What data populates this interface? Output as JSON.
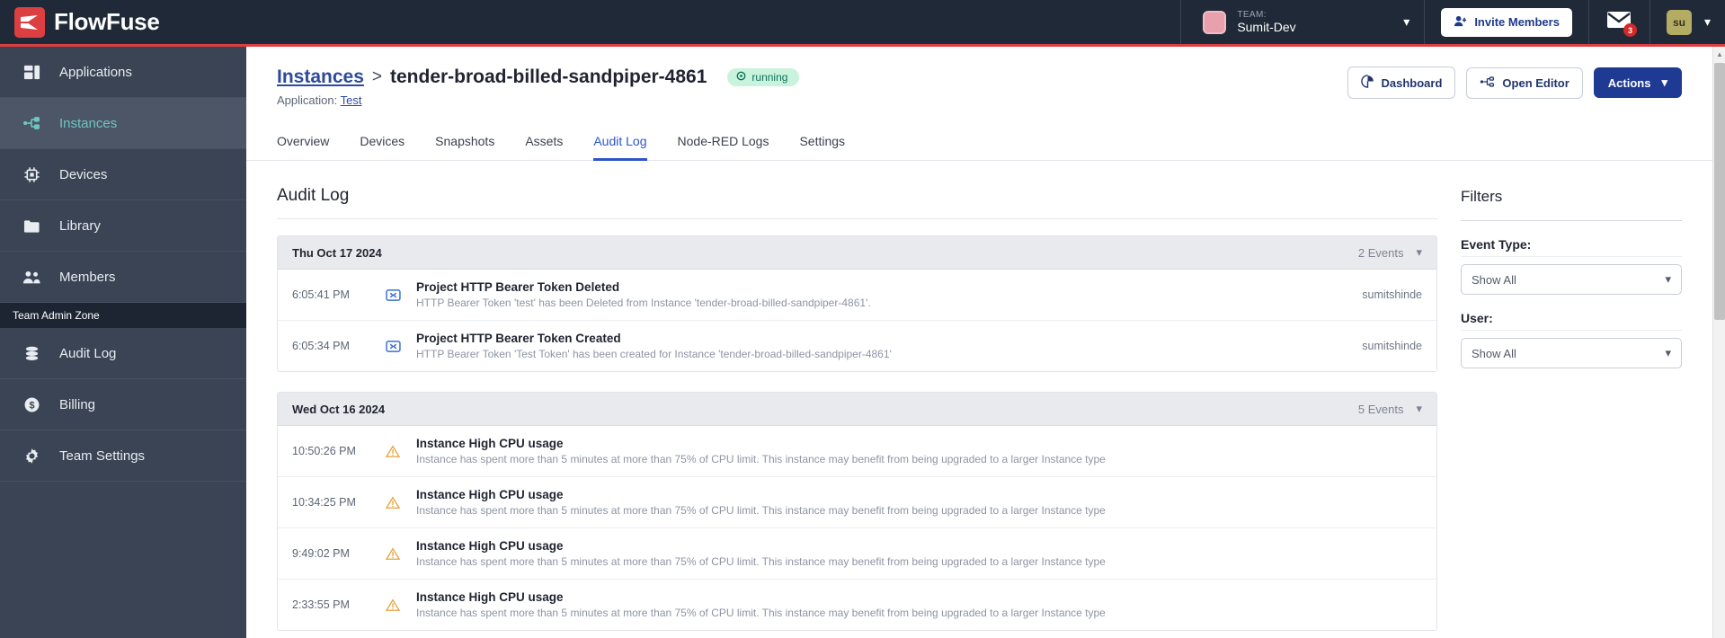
{
  "brand": {
    "name": "FlowFuse",
    "accent": "#dc3f42"
  },
  "header": {
    "team_label": "TEAM:",
    "team_name": "Sumit-Dev",
    "invite_label": "Invite Members",
    "mail_badge": "3",
    "avatar_initials": "su"
  },
  "sidebar": {
    "items": [
      {
        "label": "Applications",
        "icon": "applications-icon",
        "active": false
      },
      {
        "label": "Instances",
        "icon": "instances-icon",
        "active": true
      },
      {
        "label": "Devices",
        "icon": "devices-icon",
        "active": false
      },
      {
        "label": "Library",
        "icon": "library-icon",
        "active": false
      },
      {
        "label": "Members",
        "icon": "members-icon",
        "active": false
      }
    ],
    "section_label": "Team Admin Zone",
    "admin_items": [
      {
        "label": "Audit Log",
        "icon": "audit-log-icon"
      },
      {
        "label": "Billing",
        "icon": "billing-icon"
      },
      {
        "label": "Team Settings",
        "icon": "gear-icon"
      }
    ]
  },
  "page": {
    "breadcrumb_parent": "Instances",
    "breadcrumb_sep": ">",
    "breadcrumb_current": "tender-broad-billed-sandpiper-4861",
    "status": "running",
    "application_prefix": "Application:",
    "application_name": "Test",
    "dashboard_label": "Dashboard",
    "open_editor_label": "Open Editor",
    "actions_label": "Actions",
    "title": "Audit Log"
  },
  "tabs": [
    {
      "label": "Overview",
      "active": false
    },
    {
      "label": "Devices",
      "active": false
    },
    {
      "label": "Snapshots",
      "active": false
    },
    {
      "label": "Assets",
      "active": false
    },
    {
      "label": "Audit Log",
      "active": true
    },
    {
      "label": "Node-RED Logs",
      "active": false
    },
    {
      "label": "Settings",
      "active": false
    }
  ],
  "log_groups": [
    {
      "date": "Thu Oct 17 2024",
      "events_count": "2 Events",
      "entries": [
        {
          "time": "6:05:41 PM",
          "icon": "token-icon",
          "title": "Project HTTP Bearer Token Deleted",
          "description": "HTTP Bearer Token 'test' has been Deleted from Instance 'tender-broad-billed-sandpiper-4861'.",
          "user": "sumitshinde"
        },
        {
          "time": "6:05:34 PM",
          "icon": "token-icon",
          "title": "Project HTTP Bearer Token Created",
          "description": "HTTP Bearer Token 'Test Token' has been created for Instance 'tender-broad-billed-sandpiper-4861'",
          "user": "sumitshinde"
        }
      ]
    },
    {
      "date": "Wed Oct 16 2024",
      "events_count": "5 Events",
      "entries": [
        {
          "time": "10:50:26 PM",
          "icon": "warning-icon",
          "title": "Instance High CPU usage",
          "description": "Instance has spent more than 5 minutes at more than 75% of CPU limit. This instance may benefit from being upgraded to a larger Instance type",
          "user": ""
        },
        {
          "time": "10:34:25 PM",
          "icon": "warning-icon",
          "title": "Instance High CPU usage",
          "description": "Instance has spent more than 5 minutes at more than 75% of CPU limit. This instance may benefit from being upgraded to a larger Instance type",
          "user": ""
        },
        {
          "time": "9:49:02 PM",
          "icon": "warning-icon",
          "title": "Instance High CPU usage",
          "description": "Instance has spent more than 5 minutes at more than 75% of CPU limit. This instance may benefit from being upgraded to a larger Instance type",
          "user": ""
        },
        {
          "time": "2:33:55 PM",
          "icon": "warning-icon",
          "title": "Instance High CPU usage",
          "description": "Instance has spent more than 5 minutes at more than 75% of CPU limit. This instance may benefit from being upgraded to a larger Instance type",
          "user": ""
        }
      ]
    }
  ],
  "filters": {
    "title": "Filters",
    "event_type_label": "Event Type:",
    "event_type_value": "Show All",
    "user_label": "User:",
    "user_value": "Show All"
  },
  "colors": {
    "accent_red": "#dc3f42",
    "sidebar_bg": "#3a4454",
    "primary_blue": "#1f3a93",
    "active_tab": "#2d55c9",
    "status_green": "#12705a",
    "warning_amber": "#e8a33d"
  }
}
